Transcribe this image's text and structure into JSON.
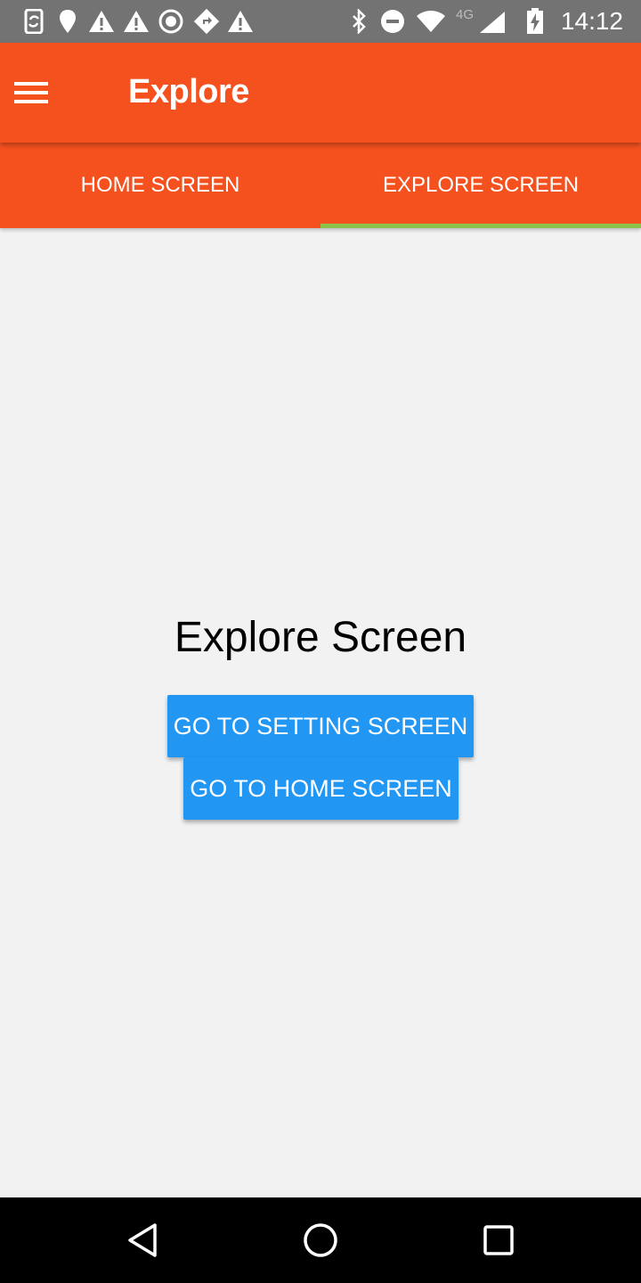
{
  "status_bar": {
    "time": "14:12",
    "network": "4G",
    "left_icons": [
      "sync-phone-icon",
      "location-pin-icon",
      "warning-icon",
      "warning-icon",
      "record-icon",
      "navigation-icon",
      "warning-icon"
    ],
    "right_icons": [
      "bluetooth-icon",
      "do-not-disturb-icon",
      "wifi-icon",
      "cellular-signal-icon",
      "battery-charging-icon"
    ]
  },
  "app_bar": {
    "title": "Explore",
    "menu_icon": "hamburger-menu-icon"
  },
  "tabs": [
    {
      "label": "HOME SCREEN",
      "selected": false
    },
    {
      "label": "EXPLORE SCREEN",
      "selected": true
    }
  ],
  "main": {
    "title": "Explore Screen",
    "setting_button_label": "GO TO SETTING SCREEN",
    "home_button_label": "GO TO HOME SCREEN"
  },
  "nav_bar": {
    "icons": [
      "back-icon",
      "home-icon",
      "recents-icon"
    ]
  },
  "colors": {
    "primary": "#f4511e",
    "tab_indicator": "#8bc34a",
    "button": "#2196f3",
    "status_bar": "#737373",
    "background": "#f2f2f2"
  }
}
